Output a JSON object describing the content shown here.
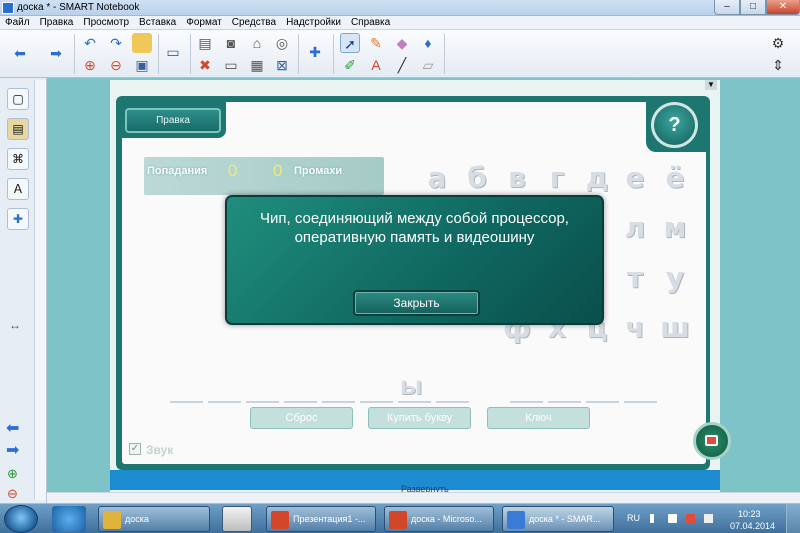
{
  "window": {
    "title": "доска * - SMART Notebook",
    "minimize": "–",
    "maximize": "□",
    "close": "✕"
  },
  "menu": [
    "Файл",
    "Правка",
    "Просмотр",
    "Вставка",
    "Формат",
    "Средства",
    "Надстройки",
    "Справка"
  ],
  "game": {
    "edit_tab": "Правка",
    "help": "?",
    "hits_label": "Попадания",
    "hits_value": "0",
    "misses_value": "0",
    "misses_label": "Промахи",
    "letters": [
      "а",
      "б",
      "в",
      "г",
      "д",
      "е",
      "ё",
      "л",
      "м",
      "т",
      "у",
      "ф",
      "х",
      "ц",
      "ч",
      "ш"
    ],
    "revealed_letter": "ы",
    "buttons": {
      "reset": "Сброс",
      "buy_letter": "Купить букву",
      "key": "Ключ"
    },
    "sound_label": "Звук",
    "sound_checked": true,
    "sound_check_glyph": "✓",
    "modal": {
      "text": "Чип, соединяющий между собой процессор, оперативную память и видеошину",
      "close_label": "Закрыть"
    }
  },
  "page": {
    "expand_link": "Развернуть"
  },
  "taskbar": {
    "items": [
      {
        "label": "доска",
        "color": "#e0b43a"
      },
      {
        "label": "Презентация1 -...",
        "color": "#d2472a"
      },
      {
        "label": "доска - Microso...",
        "color": "#d2472a"
      },
      {
        "label": "доска * - SMAR...",
        "color": "#3a7bd5"
      }
    ],
    "language": "RU",
    "time": "10:23",
    "date": "07.04.2014"
  },
  "colors": {
    "board_teal": "#1e7671",
    "modal_teal": "#0f6660",
    "accent_yellow": "#f1e97a"
  }
}
